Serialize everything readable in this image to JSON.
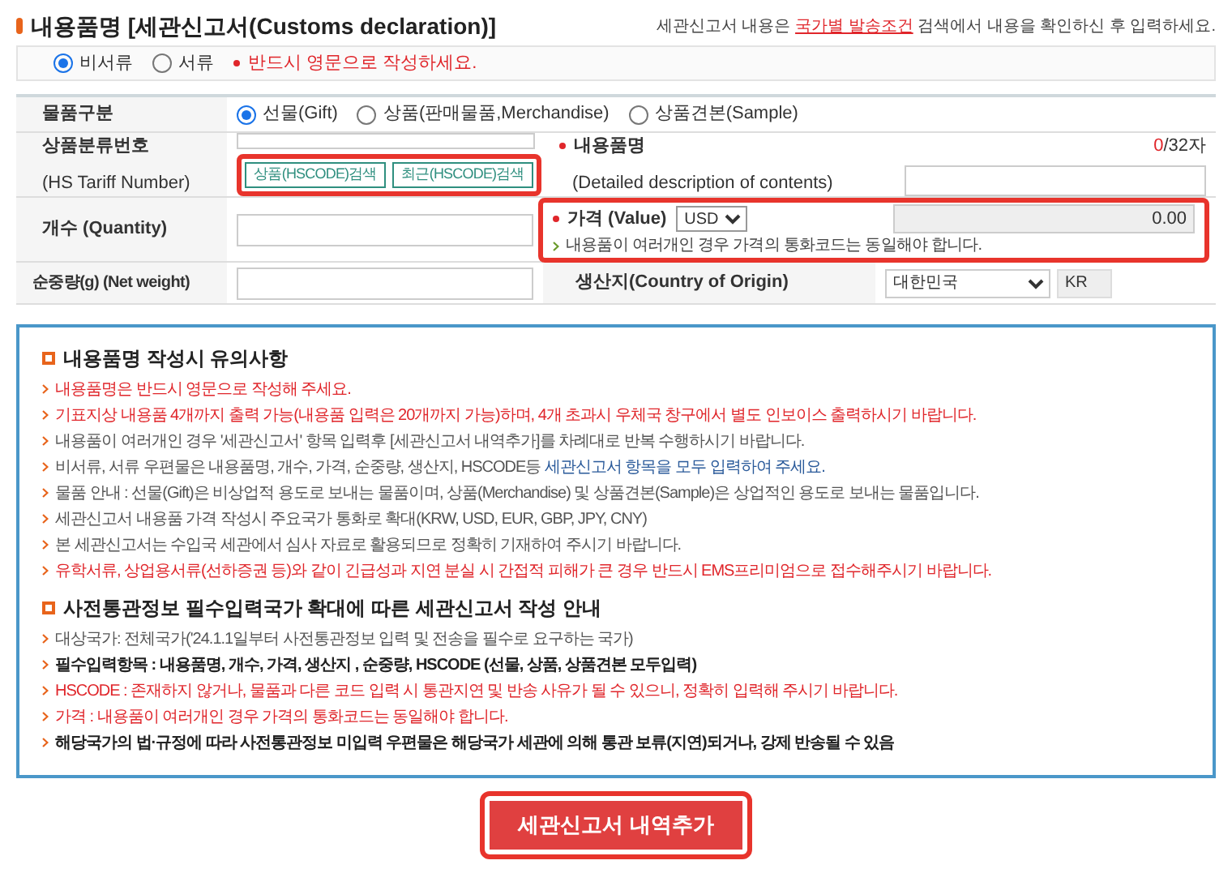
{
  "header": {
    "title": "내용품명 [세관신고서(Customs declaration)]",
    "hint_before": "세관신고서 내용은",
    "hint_link": "국가별 발송조건",
    "hint_after": "검색에서 내용을 확인하신 후 입력하세요."
  },
  "doc_type": {
    "options": [
      {
        "label": "비서류",
        "selected": true
      },
      {
        "label": "서류",
        "selected": false
      }
    ],
    "warning": "반드시 영문으로 작성하세요."
  },
  "form": {
    "item_type": {
      "label": "물품구분",
      "options": [
        {
          "label": "선물(Gift)",
          "selected": true
        },
        {
          "label": "상품(판매물품,Merchandise)",
          "selected": false
        },
        {
          "label": "상품견본(Sample)",
          "selected": false
        }
      ]
    },
    "hs": {
      "label_ko": "상품분류번호",
      "label_en": "(HS Tariff Number)",
      "buttons": [
        "상품(HSCODE)검색",
        "최근(HSCODE)검색"
      ]
    },
    "contents": {
      "label_ko": "내용품명",
      "label_en": "(Detailed description of contents)",
      "count_used": "0",
      "count_max": "/32자"
    },
    "quantity": {
      "label": "개수 (Quantity)"
    },
    "value": {
      "label": "가격 (Value)",
      "currency": "USD",
      "note": "내용품이 여러개인 경우 가격의 통화코드는 동일해야 합니다.",
      "amount": "0.00"
    },
    "weight": {
      "label": "순중량(g) (Net weight)"
    },
    "origin": {
      "label": "생산지(Country of Origin)",
      "country": "대한민국",
      "code": "KR"
    }
  },
  "notices": [
    {
      "title": "내용품명 작성시 유의사항",
      "items": [
        [
          {
            "text": "내용품명은 반드시 영문으로 작성해 주세요.",
            "color": "#e0262b",
            "bold": false
          }
        ],
        [
          {
            "text": "기표지상 내용품 4개까지 출력 가능(내용품 입력은 20개까지 가능)하며, 4개 초과시 우체국 창구에서 별도 인보이스 출력하시기 바랍니다.",
            "color": "#e0262b",
            "bold": false
          }
        ],
        [
          {
            "text": "내용품이 여러개인 경우 '세관신고서' 항목 입력후 [세관신고서 내역추가]를 차례대로 반복 수행하시기 바랍니다.",
            "color": "#555555",
            "bold": false
          }
        ],
        [
          {
            "text": "비서류, 서류 우편물은 내용품명, 개수, 가격, 순중량, 생산지, HSCODE등 ",
            "color": "#555555",
            "bold": false
          },
          {
            "text": "세관신고서 항목을 모두 입력하여 주세요.",
            "color": "#2a5a9a",
            "bold": false
          }
        ],
        [
          {
            "text": "물품 안내 : 선물(Gift)은 비상업적 용도로 보내는 물품이며, 상품(Merchandise) 및 상품견본(Sample)은 상업적인 용도로 보내는 물품입니다.",
            "color": "#555555",
            "bold": false
          }
        ],
        [
          {
            "text": "세관신고서 내용품 가격 작성시 주요국가 통화로 확대(KRW, USD, EUR, GBP, JPY, CNY)",
            "color": "#555555",
            "bold": false
          }
        ],
        [
          {
            "text": "본 세관신고서는 수입국 세관에서 심사 자료로 활용되므로 정확히 기재하여 주시기 바랍니다.",
            "color": "#555555",
            "bold": false
          }
        ],
        [
          {
            "text": "유학서류, 상업용서류(선하증권 등)와 같이 긴급성과 지연 분실 시 간접적 피해가 큰 경우 반드시 EMS프리미엄으로 접수해주시기 바랍니다.",
            "color": "#e0262b",
            "bold": false
          }
        ]
      ]
    },
    {
      "title": "사전통관정보 필수입력국가 확대에 따른 세관신고서 작성 안내",
      "items": [
        [
          {
            "text": "대상국가: 전체국가('24.1.1일부터 사전통관정보 입력 및 전송을 필수로 요구하는 국가)",
            "color": "#555555",
            "bold": false
          }
        ],
        [
          {
            "text": "필수입력항목 : 내용품명, 개수, 가격, 생산지 , 순중량, HSCODE (선물, 상품, 상품견본 모두입력)",
            "color": "#222222",
            "bold": true
          }
        ],
        [
          {
            "text": "HSCODE : 존재하지 않거나, 물품과 다른 코드 입력 시 통관지연 및 반송 사유가 될 수 있으니, 정확히 입력해 주시기 바랍니다.",
            "color": "#e0262b",
            "bold": false
          }
        ],
        [
          {
            "text": "가격 : 내용품이 여러개인 경우 가격의 통화코드는 동일해야 합니다.",
            "color": "#e0262b",
            "bold": false
          }
        ],
        [
          {
            "text": "해당국가의 법·규정에 따라 사전통관정보 미입력 우편물은 해당국가 세관에 의해 통관 보류(지연)되거나, 강제 반송될 수 있음",
            "color": "#222222",
            "bold": true
          }
        ]
      ]
    }
  ],
  "submit_button": "세관신고서 내역추가"
}
